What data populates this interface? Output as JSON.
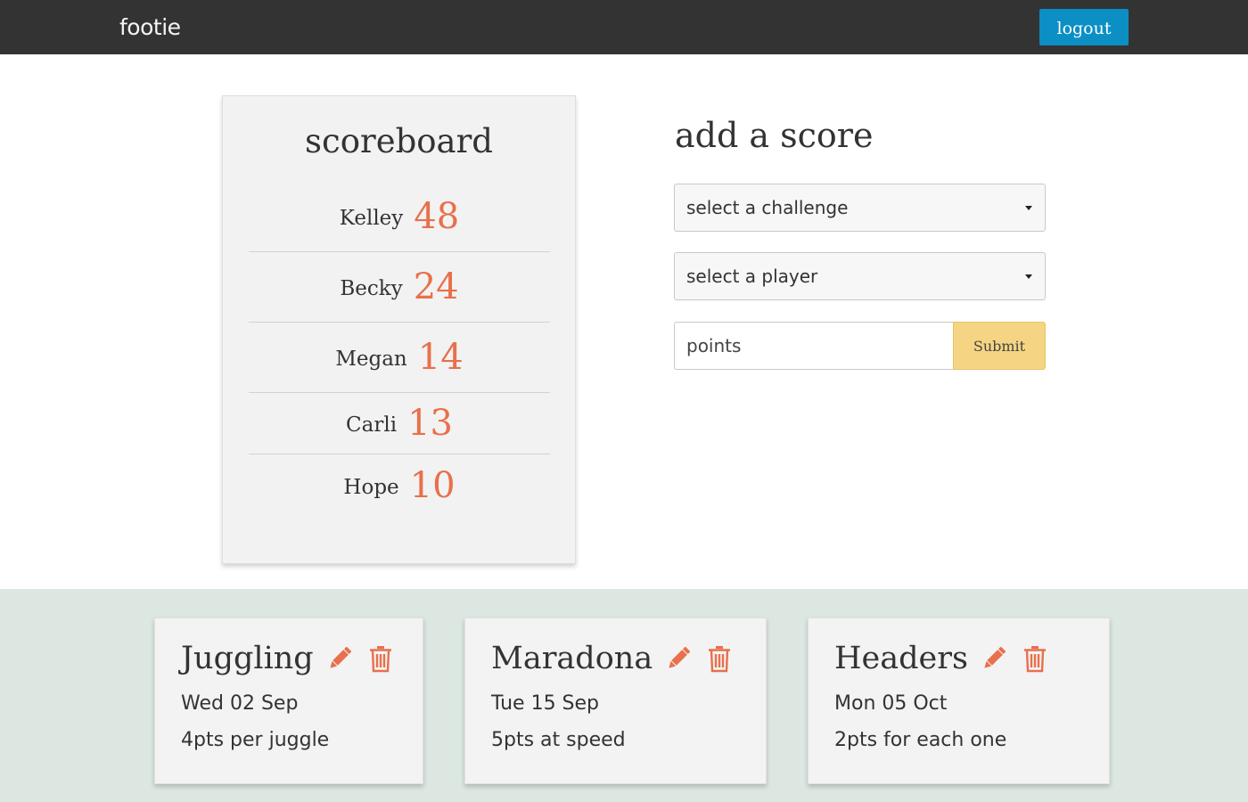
{
  "navbar": {
    "brand": "footie",
    "logout_label": "logout"
  },
  "scoreboard": {
    "title": "scoreboard",
    "rows": [
      {
        "name": "Kelley",
        "points": "48"
      },
      {
        "name": "Becky",
        "points": "24"
      },
      {
        "name": "Megan",
        "points": "14"
      },
      {
        "name": "Carli",
        "points": "13"
      },
      {
        "name": "Hope",
        "points": "10"
      }
    ]
  },
  "add_score": {
    "title": "add a score",
    "challenge_select": "select a challenge",
    "player_select": "select a player",
    "points_placeholder": "points",
    "submit_label": "Submit"
  },
  "challenges": [
    {
      "title": "Juggling",
      "date": "Wed 02 Sep",
      "desc": "4pts per juggle"
    },
    {
      "title": "Maradona",
      "date": "Tue 15 Sep",
      "desc": "5pts at speed"
    },
    {
      "title": "Headers",
      "date": "Mon 05 Oct",
      "desc": "2pts for each one"
    }
  ],
  "icons": {
    "edit": "pencil-icon",
    "delete": "trash-icon",
    "dropdown": "caret-down-icon"
  },
  "colors": {
    "accent": "#e8704c",
    "navbar": "#333333",
    "logout": "#0c8fc4",
    "submit": "#f5d483",
    "band": "#dce7e2"
  }
}
